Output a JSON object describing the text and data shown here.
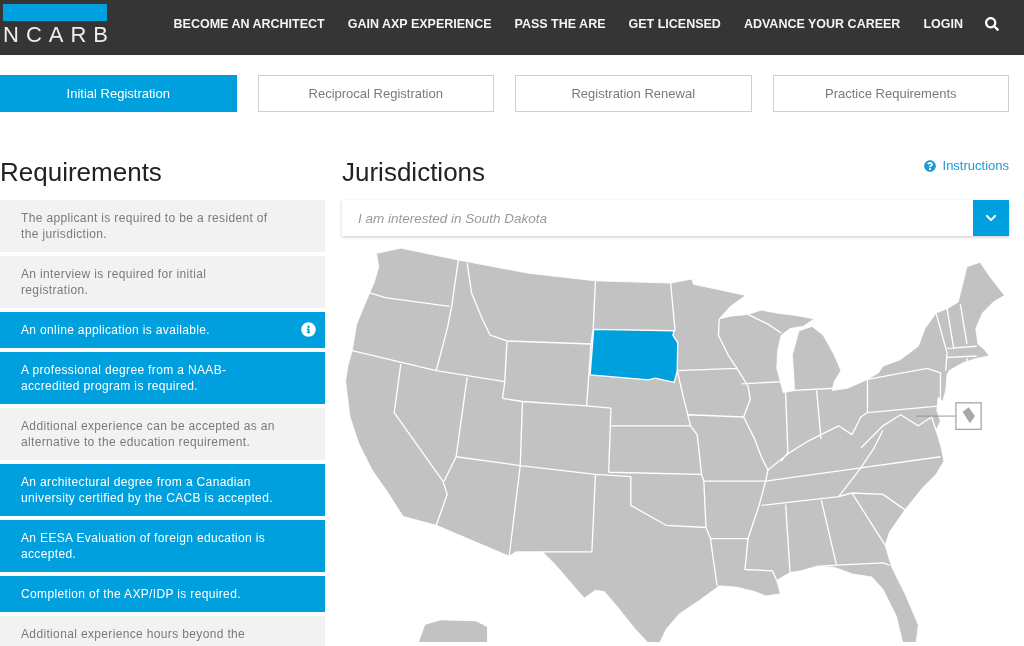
{
  "header": {
    "logo": "NCARB",
    "nav": [
      "BECOME AN ARCHITECT",
      "GAIN AXP EXPERIENCE",
      "PASS THE ARE",
      "GET LICENSED",
      "ADVANCE YOUR CAREER",
      "LOGIN"
    ]
  },
  "tabs": [
    {
      "label": "Initial Registration",
      "selected": true
    },
    {
      "label": "Reciprocal Registration",
      "selected": false
    },
    {
      "label": "Registration Renewal",
      "selected": false
    },
    {
      "label": "Practice Requirements",
      "selected": false
    }
  ],
  "requirements": {
    "title": "Requirements",
    "items": [
      {
        "text": "The applicant is required to be a resident of the jurisdiction.",
        "highlighted": false,
        "info": false
      },
      {
        "text": "An interview is required for initial registration.",
        "highlighted": false,
        "info": false
      },
      {
        "text": "An online application is available.",
        "highlighted": true,
        "info": true
      },
      {
        "text": "A professional degree from a NAAB-accredited program is required.",
        "highlighted": true,
        "info": false
      },
      {
        "text": "Additional experience can be accepted as an alternative to the education requirement.",
        "highlighted": false,
        "info": false
      },
      {
        "text": "An architectural degree from a Canadian university certified by the CACB is accepted.",
        "highlighted": true,
        "info": false
      },
      {
        "text": "An EESA Evaluation of foreign education is accepted.",
        "highlighted": true,
        "info": false
      },
      {
        "text": "Completion of the AXP/IDP is required.",
        "highlighted": true,
        "info": false
      },
      {
        "text": "Additional experience hours beyond the",
        "highlighted": false,
        "info": false
      }
    ]
  },
  "jurisdictions": {
    "title": "Jurisdictions",
    "instructions": "Instructions",
    "select": {
      "value": "I am interested in South Dakota"
    }
  }
}
